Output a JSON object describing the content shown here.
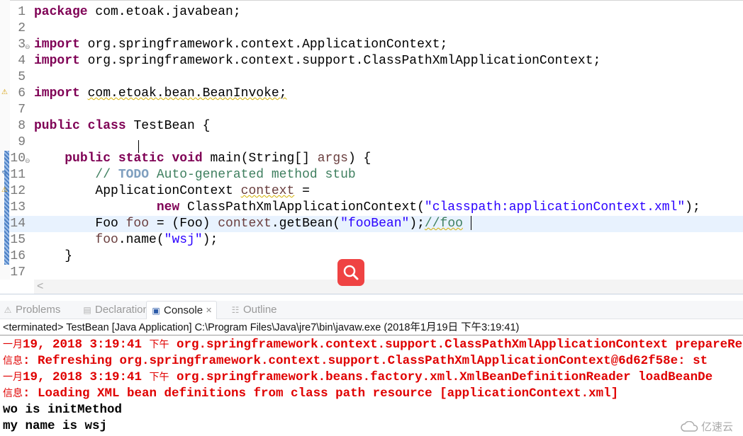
{
  "editor": {
    "current_line": 14,
    "lines": [
      {
        "n": "1",
        "tokens": [
          [
            "package",
            "kw"
          ],
          [
            " com.etoak.javabean;",
            "plain"
          ]
        ]
      },
      {
        "n": "2",
        "tokens": []
      },
      {
        "n": "3",
        "fold": true,
        "tokens": [
          [
            "import",
            "kw"
          ],
          [
            " org.springframework.context.ApplicationContext;",
            "plain"
          ]
        ]
      },
      {
        "n": "4",
        "tokens": [
          [
            "import",
            "kw"
          ],
          [
            " org.springframework.context.support.ClassPathXmlApplicationContext;",
            "plain"
          ]
        ]
      },
      {
        "n": "5",
        "tokens": []
      },
      {
        "n": "6",
        "marker": "warning",
        "tokens": [
          [
            "import",
            "kw"
          ],
          [
            " ",
            "plain"
          ],
          [
            "com.etoak.bean.BeanInvoke;",
            "plain warn"
          ]
        ]
      },
      {
        "n": "7",
        "tokens": []
      },
      {
        "n": "8",
        "tokens": [
          [
            "public",
            "kw"
          ],
          [
            " ",
            "plain"
          ],
          [
            "class",
            "kw"
          ],
          [
            " TestBean {",
            "plain"
          ]
        ]
      },
      {
        "n": "9",
        "tokens": []
      },
      {
        "n": "10",
        "fold": true,
        "changed": true,
        "tokens": [
          [
            "    ",
            "plain"
          ],
          [
            "public",
            "kw"
          ],
          [
            " ",
            "plain"
          ],
          [
            "static",
            "kw"
          ],
          [
            " ",
            "plain"
          ],
          [
            "void",
            "kw"
          ],
          [
            " main(String[] ",
            "plain"
          ],
          [
            "args",
            "var"
          ],
          [
            ") {",
            "plain"
          ]
        ]
      },
      {
        "n": "11",
        "marker": "task",
        "changed": true,
        "tokens": [
          [
            "        // ",
            "cmt"
          ],
          [
            "TODO",
            "todo"
          ],
          [
            " Auto-generated method stub",
            "cmt"
          ]
        ]
      },
      {
        "n": "12",
        "marker": "warning",
        "changed": true,
        "tokens": [
          [
            "        ApplicationContext ",
            "plain"
          ],
          [
            "context",
            "var warn"
          ],
          [
            " =",
            "plain"
          ]
        ]
      },
      {
        "n": "13",
        "changed": true,
        "tokens": [
          [
            "                ",
            "plain"
          ],
          [
            "new",
            "kw"
          ],
          [
            " ClassPathXmlApplicationContext(",
            "plain"
          ],
          [
            "\"classpath:applicationContext.xml\"",
            "str"
          ],
          [
            ");",
            "plain"
          ]
        ]
      },
      {
        "n": "14",
        "changed": true,
        "tokens": [
          [
            "        Foo ",
            "plain"
          ],
          [
            "foo",
            "var"
          ],
          [
            " = (Foo) ",
            "plain"
          ],
          [
            "context",
            "var"
          ],
          [
            ".getBean(",
            "plain"
          ],
          [
            "\"fooBean\"",
            "str"
          ],
          [
            ");",
            "plain"
          ],
          [
            "//foo",
            "cmt warn"
          ]
        ]
      },
      {
        "n": "15",
        "changed": true,
        "tokens": [
          [
            "        ",
            "plain"
          ],
          [
            "foo",
            "var"
          ],
          [
            ".name(",
            "plain"
          ],
          [
            "\"wsj\"",
            "str"
          ],
          [
            ");",
            "plain"
          ]
        ]
      },
      {
        "n": "16",
        "changed": true,
        "tokens": [
          [
            "    }",
            "plain"
          ]
        ]
      },
      {
        "n": "17",
        "tokens": []
      }
    ],
    "scroll_left_glyph": "<"
  },
  "panel": {
    "tabs": [
      {
        "label": "Problems",
        "icon": "problems-icon",
        "glyph": "⚠",
        "active": false
      },
      {
        "label": "Declaration",
        "icon": "declaration-icon",
        "glyph": "▤",
        "active": false
      },
      {
        "label": "Console",
        "icon": "console-icon",
        "glyph": "▣",
        "active": true,
        "close": "✕"
      },
      {
        "label": "Outline",
        "icon": "outline-icon",
        "glyph": "☷",
        "active": false
      }
    ],
    "status": "<terminated> TestBean [Java Application] C:\\Program Files\\Java\\jre7\\bin\\javaw.exe (2018年1月19日 下午3:19:41)",
    "console": [
      {
        "color": "red",
        "cjk": "一月",
        "text": "19, 2018 3:19:41 ",
        "cjk2": "下午",
        "text2": " org.springframework.context.support.ClassPathXmlApplicationContext prepareRefresh"
      },
      {
        "color": "red",
        "cjk": "信息",
        "text": ": Refreshing org.springframework.context.support.ClassPathXmlApplicationContext@6d62f58e: st"
      },
      {
        "color": "red",
        "cjk": "一月",
        "text": "19, 2018 3:19:41 ",
        "cjk2": "下午",
        "text2": " org.springframework.beans.factory.xml.XmlBeanDefinitionReader loadBeanDe"
      },
      {
        "color": "red",
        "cjk": "信息",
        "text": ": Loading XML bean definitions from class path resource [applicationContext.xml]"
      },
      {
        "color": "black",
        "text": "wo is initMethod"
      },
      {
        "color": "black",
        "text": "my name is wsj"
      }
    ]
  },
  "overlay": {
    "search_button": "search-icon"
  },
  "watermark": "亿速云",
  "colors": {
    "keyword": "#7f0055",
    "string": "#2a00ff",
    "comment": "#3f7f5f",
    "console_error": "#e00000",
    "search_button": "#ef4343",
    "current_line": "#e8f2fe"
  }
}
